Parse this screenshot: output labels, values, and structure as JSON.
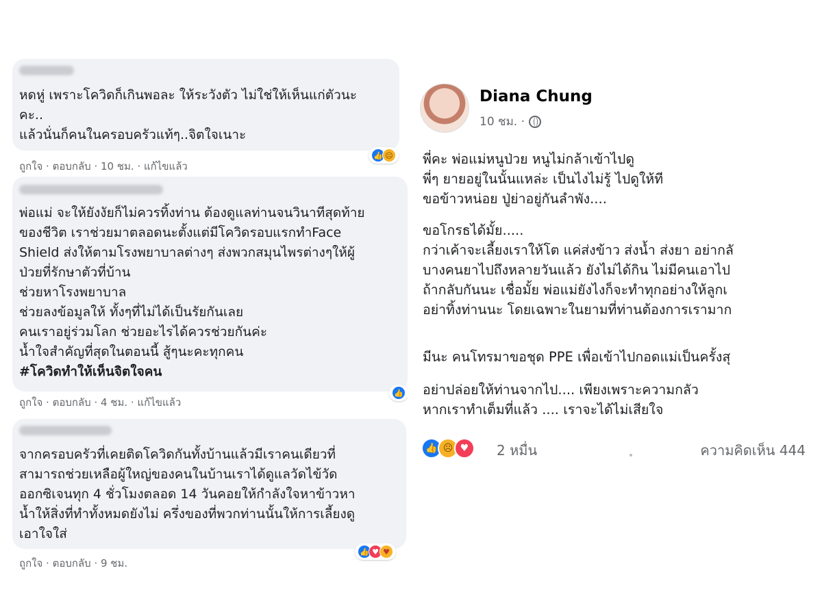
{
  "comments": [
    {
      "text": "หดหู่ เพราะโควิดก็เกินพอละ ให้ระวังตัว ไม่ใช่ให้เห็นแก่ตัวนะ\nคะ..\nแล้วนั่นก็คนในครอบครัวแท้ๆ..จิตใจเนาะ",
      "like_label": "ถูกใจ",
      "reply_label": "ตอบกลับ",
      "time": "10 ชม.",
      "edited_label": "แก้ไขแล้ว"
    },
    {
      "text": "พ่อแม่ จะให้ยังงัยก็ไม่ควรทิ้งท่าน ต้องดูแลท่านจนวินาทีสุดท้าย\nของชีวิต เราช่วยมาตลอดนะตั้งแต่มีโควิดรอบแรกทำFace\nShield ส่งให้ตามโรงพยาบาลต่างๆ ส่งพวกสมุนไพรต่างๆให้ผู้\nป่วยที่รักษาตัวที่บ้าน\nช่วยหาโรงพยาบาล\nช่วยลงข้อมูลให้ ทั้งๆที่ไม่ได้เป็นรัยกันเลย\nคนเราอยู่ร่วมโลก ช่วยอะไรได้ควรช่วยกันค่ะ\nน้ำใจสำคัญที่สุดในตอนนี้ สู้ๆนะคะทุกคน",
      "hashtag": "#โควิดทำให้เห็นจิตใจคน",
      "like_label": "ถูกใจ",
      "reply_label": "ตอบกลับ",
      "time": "4 ชม.",
      "edited_label": "แก้ไขแล้ว"
    },
    {
      "text": "จากครอบครัวที่เคยติดโควิดกันทั้งบ้านแล้วมีเราคนเดียวที่\nสามารถช่วยเหลือผู้ใหญ่ของคนในบ้านเราได้ดูแลวัดไข้วัด\nออกซิเจนทุก 4 ชั่วโมงตลอด 14 วันคอยให้กำลังใจหาข้าวหา\nน้ำให้สิ่งที่ทำทั้งหมดยังไม่ ครึ่งของที่พวกท่านนั้นให้การเลี้ยงดู\nเอาใจใส่",
      "like_label": "ถูกใจ",
      "reply_label": "ตอบกลับ",
      "time": "9 ชม."
    }
  ],
  "post": {
    "author": "Diana Chung",
    "time": "10 ชม. ·",
    "paragraphs": [
      "พี่คะ พ่อแม่หนูป่วย หนูไม่กล้าเข้าไปดู\nพี่ๆ ยายอยู่ในนั้นแหล่ะ เป็นไงไม่รู้ ไปดูให้ที\nขอข้าวหน่อย ปู่ย่าอยู่กันลำพัง....",
      "ขอโกรธได้มั้ย.....\nกว่าเค้าจะเลี้ยงเราให้โต แค่ส่งข้าว ส่งน้ำ ส่งยา อย่ากลั\nบางคนยาไปถึงหลายวันแล้ว ยังไม่ได้กิน ไม่มีคนเอาไป\nถ้ากลับกันนะ เชื่อมั้ย พ่อแม่ยังไงก็จะทำทุกอย่างให้ลูกเ\nอย่าทิ้งท่านนะ โดยเฉพาะในยามที่ท่านต้องการเรามาก",
      "มีนะ คนโทรมาขอชุด PPE เพื่อเข้าไปกอดแม่เป็นครั้งสุ",
      "อย่าปล่อยให้ท่านจากไป.... เพียงเพราะความกลัว\nหากเราทำเต็มที่แล้ว .... เราจะได้ไม่เสียใจ"
    ],
    "reaction_count": "2 หมื่น",
    "comments_label": "ความคิดเห็น 444"
  }
}
